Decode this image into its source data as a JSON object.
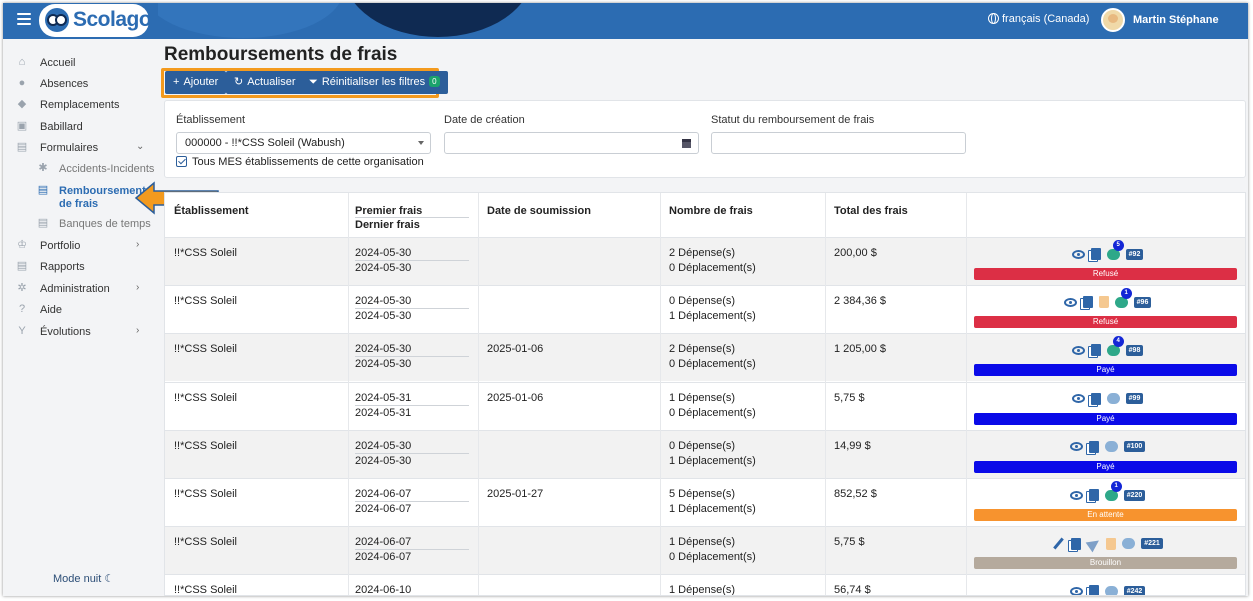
{
  "app": {
    "logo_text": "Scolago",
    "language": "français (Canada)",
    "user_name": "Martin Stéphane"
  },
  "sidebar": {
    "items": [
      {
        "label": "Accueil",
        "icon": "home-icon"
      },
      {
        "label": "Absences",
        "icon": "person-absent-icon"
      },
      {
        "label": "Remplacements",
        "icon": "replace-icon"
      },
      {
        "label": "Babillard",
        "icon": "board-icon"
      },
      {
        "label": "Formulaires",
        "icon": "form-icon"
      },
      {
        "label": "Accidents-Incidents",
        "icon": "accident-icon"
      },
      {
        "label": "Remboursements de frais",
        "icon": "receipt-icon"
      },
      {
        "label": "Banques de temps",
        "icon": "time-bank-icon"
      },
      {
        "label": "Portfolio",
        "icon": "trophy-icon"
      },
      {
        "label": "Rapports",
        "icon": "report-icon"
      },
      {
        "label": "Administration",
        "icon": "gear-icon"
      },
      {
        "label": "Aide",
        "icon": "help-icon"
      },
      {
        "label": "Évolutions",
        "icon": "sprout-icon"
      }
    ],
    "mode_nuit": "Mode nuit"
  },
  "page": {
    "title": "Remboursements de frais"
  },
  "toolbar": {
    "add_label": "Ajouter",
    "refresh_label": "Actualiser",
    "reset_label": "Réinitialiser les filtres",
    "reset_count": "0"
  },
  "filters": {
    "etablissement_label": "Établissement",
    "etablissement_value": "000000 - !!*CSS Soleil (Wabush)",
    "date_label": "Date de création",
    "date_value": "",
    "statut_label": "Statut du remboursement de frais",
    "statut_value": "",
    "tous_label": "Tous MES établissements de cette organisation"
  },
  "table": {
    "headers": {
      "etablissement": "Établissement",
      "premier": "Premier frais",
      "dernier": "Dernier frais",
      "soumission": "Date de soumission",
      "nombre": "Nombre de frais",
      "total": "Total des frais"
    },
    "rows": [
      {
        "etab": "!!*CSS Soleil",
        "premier": "2024-05-30",
        "dernier": "2024-05-30",
        "soumission": "",
        "depenses": "2 Dépense(s)",
        "deplacements": "0 Déplacement(s)",
        "total": "200,00 $",
        "number": "#92",
        "msg_count": "5",
        "status": "Refusé",
        "status_color": "#dc2f45",
        "icons": [
          "eye",
          "copy",
          "chat-green"
        ]
      },
      {
        "etab": "!!*CSS Soleil",
        "premier": "2024-05-30",
        "dernier": "2024-05-30",
        "soumission": "",
        "depenses": "0 Dépense(s)",
        "deplacements": "1 Déplacement(s)",
        "total": "2 384,36 $",
        "number": "#96",
        "msg_count": "1",
        "status": "Refusé",
        "status_color": "#dc2f45",
        "icons": [
          "eye",
          "copy",
          "trash",
          "chat-green"
        ]
      },
      {
        "etab": "!!*CSS Soleil",
        "premier": "2024-05-30",
        "dernier": "2024-05-30",
        "soumission": "2025-01-06",
        "depenses": "2 Dépense(s)",
        "deplacements": "0 Déplacement(s)",
        "total": "1 205,00 $",
        "number": "#98",
        "msg_count": "4",
        "status": "Payé",
        "status_color": "#0a0ae8",
        "icons": [
          "eye",
          "copy",
          "chat-green"
        ]
      },
      {
        "etab": "!!*CSS Soleil",
        "premier": "2024-05-31",
        "dernier": "2024-05-31",
        "soumission": "2025-01-06",
        "depenses": "1 Dépense(s)",
        "deplacements": "0 Déplacement(s)",
        "total": "5,75 $",
        "number": "#99",
        "msg_count": "",
        "status": "Payé",
        "status_color": "#0a0ae8",
        "icons": [
          "eye",
          "copy",
          "chat"
        ]
      },
      {
        "etab": "!!*CSS Soleil",
        "premier": "2024-05-30",
        "dernier": "2024-05-30",
        "soumission": "",
        "depenses": "0 Dépense(s)",
        "deplacements": "1 Déplacement(s)",
        "total": "14,99 $",
        "number": "#100",
        "msg_count": "",
        "status": "Payé",
        "status_color": "#0a0ae8",
        "icons": [
          "eye",
          "copy",
          "chat"
        ]
      },
      {
        "etab": "!!*CSS Soleil",
        "premier": "2024-06-07",
        "dernier": "2024-06-07",
        "soumission": "2025-01-27",
        "depenses": "5 Dépense(s)",
        "deplacements": "1 Déplacement(s)",
        "total": "852,52 $",
        "number": "#220",
        "msg_count": "1",
        "status": "En attente",
        "status_color": "#f7932e",
        "icons": [
          "eye",
          "copy",
          "chat-green"
        ]
      },
      {
        "etab": "!!*CSS Soleil",
        "premier": "2024-06-07",
        "dernier": "2024-06-07",
        "soumission": "",
        "depenses": "1 Dépense(s)",
        "deplacements": "0 Déplacement(s)",
        "total": "5,75 $",
        "number": "#221",
        "msg_count": "",
        "status": "Brouillon",
        "status_color": "#b5aa9d",
        "icons": [
          "edit",
          "copy",
          "send",
          "trash",
          "chat"
        ]
      },
      {
        "etab": "!!*CSS Soleil",
        "premier": "2024-06-10",
        "dernier": "",
        "soumission": "",
        "depenses": "1 Dépense(s)",
        "deplacements": "",
        "total": "56,74 $",
        "number": "#242",
        "msg_count": "",
        "status": "",
        "status_color": "",
        "icons": [
          "eye",
          "copy",
          "chat"
        ]
      }
    ]
  },
  "colors": {
    "topbar": "#2c6cb2",
    "highlight": "#f39a1e",
    "button": "#2c5e9a"
  }
}
